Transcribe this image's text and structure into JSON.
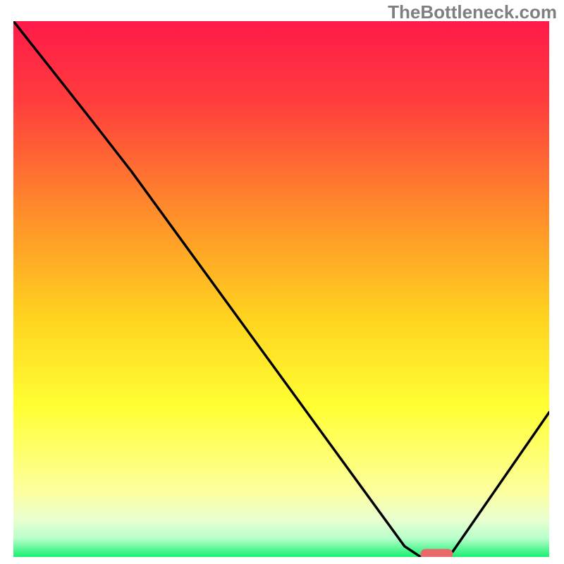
{
  "watermark": "TheBottleneck.com",
  "chart_data": {
    "type": "line",
    "title": "",
    "xlabel": "",
    "ylabel": "",
    "xlim": [
      0,
      100
    ],
    "ylim": [
      0,
      100
    ],
    "grid": false,
    "legend": false,
    "background_gradient": {
      "stops": [
        {
          "offset": 0.0,
          "color": "#ff1a4a"
        },
        {
          "offset": 0.15,
          "color": "#ff3d3d"
        },
        {
          "offset": 0.35,
          "color": "#ff8a2b"
        },
        {
          "offset": 0.55,
          "color": "#ffd21f"
        },
        {
          "offset": 0.72,
          "color": "#ffff33"
        },
        {
          "offset": 0.88,
          "color": "#fcffa0"
        },
        {
          "offset": 0.93,
          "color": "#eaffd0"
        },
        {
          "offset": 0.965,
          "color": "#b8ffcc"
        },
        {
          "offset": 1.0,
          "color": "#18f070"
        }
      ]
    },
    "series": [
      {
        "name": "bottleneck-curve",
        "color": "#000000",
        "x": [
          0,
          15,
          22,
          73,
          76,
          80,
          82,
          100
        ],
        "y": [
          100,
          81,
          72,
          2,
          0,
          0,
          1,
          27
        ]
      }
    ],
    "marker": {
      "name": "target-marker",
      "color": "#e86a6a",
      "x_start": 76,
      "x_end": 82,
      "y": 0.5,
      "height": 2.0
    }
  }
}
